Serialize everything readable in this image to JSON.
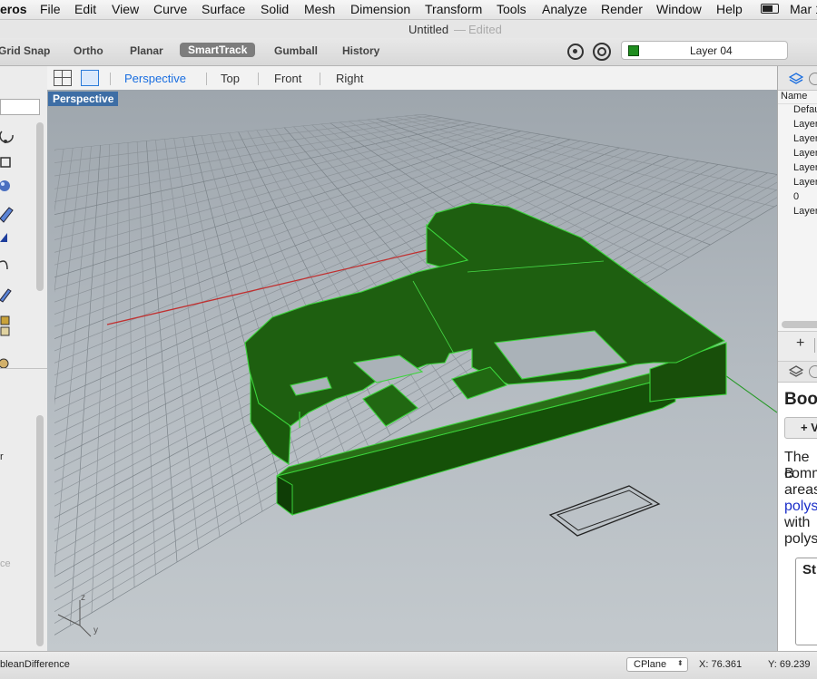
{
  "menubar": {
    "app": "eros",
    "items": [
      "File",
      "Edit",
      "View",
      "Curve",
      "Surface",
      "Solid",
      "Mesh",
      "Dimension",
      "Transform",
      "Tools",
      "Analyze",
      "Render",
      "Window",
      "Help"
    ],
    "clock": "Mar 1"
  },
  "titlebar": {
    "title": "Untitled",
    "sep": "—",
    "state": "Edited"
  },
  "toolbar": {
    "toggles": [
      "Grid Snap",
      "Ortho",
      "Planar",
      "SmartTrack",
      "Gumball",
      "History"
    ],
    "active": "SmartTrack",
    "layer_label": "Layer 04",
    "layer_color": "#1e8d1e"
  },
  "viewbar": {
    "tabs": [
      "Perspective",
      "Top",
      "Front",
      "Right"
    ],
    "active": "Perspective"
  },
  "viewport": {
    "label": "Perspective",
    "axis_z": "z",
    "axis_y": "y"
  },
  "left_panel": {
    "labels": [
      "r",
      "ce"
    ]
  },
  "right_panel": {
    "layers_header": "Name",
    "layers": [
      "Defau",
      "Layer",
      "Layer",
      "Layer",
      "Layer",
      "Layer",
      "0",
      "Layer"
    ],
    "help_title": "Bool",
    "help_button": "+ V",
    "help_text": [
      "The B",
      "comm",
      "areas",
      "polys",
      "with",
      "polys"
    ],
    "help_heading": "St"
  },
  "statusbar": {
    "command": "bleanDifference",
    "cplane": "CPlane",
    "x": "X: 76.361",
    "y": "Y: 69.239"
  },
  "colors": {
    "accent": "#1a6ee0",
    "model_green": "#1b5e0f",
    "model_edge": "#3bd43b",
    "x_axis": "#c03030",
    "y_axis": "#2a9a2a"
  }
}
